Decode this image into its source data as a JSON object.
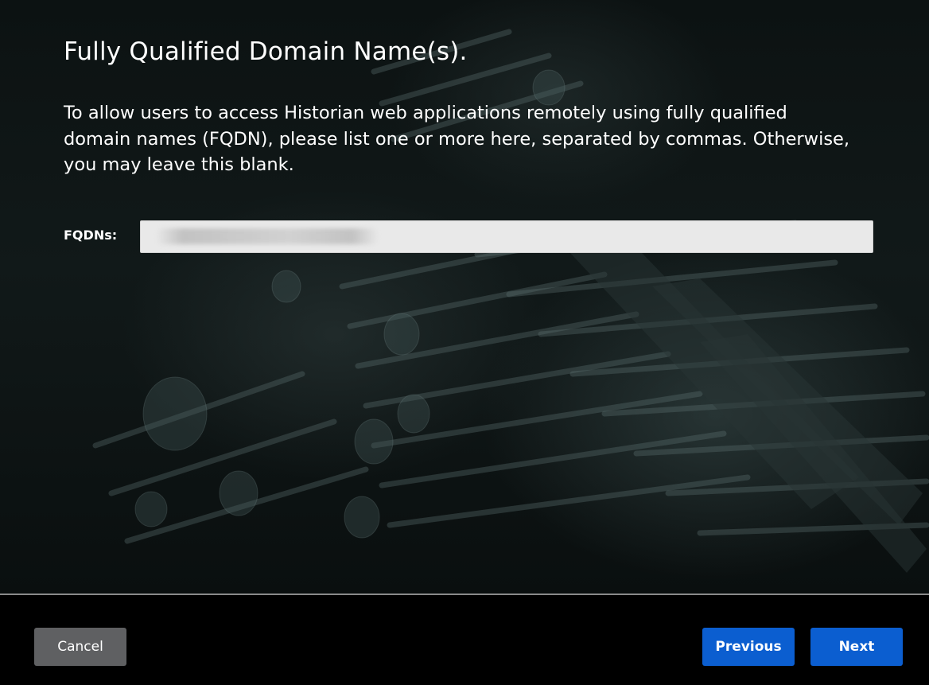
{
  "page": {
    "title": "Fully Qualified Domain Name(s).",
    "description": "To allow users to access Historian web applications remotely using fully qualified domain names (FQDN), please list one or more here, separated by commas. Otherwise, you may leave this blank."
  },
  "form": {
    "fqdn_label": "FQDNs:",
    "fqdn_value": "",
    "fqdn_placeholder": ""
  },
  "footer": {
    "cancel_label": "Cancel",
    "previous_label": "Previous",
    "next_label": "Next"
  },
  "colors": {
    "primary_button": "#0b5ed0",
    "secondary_button": "#5f6062",
    "background": "#000000",
    "input_background": "#e9e9e9"
  }
}
